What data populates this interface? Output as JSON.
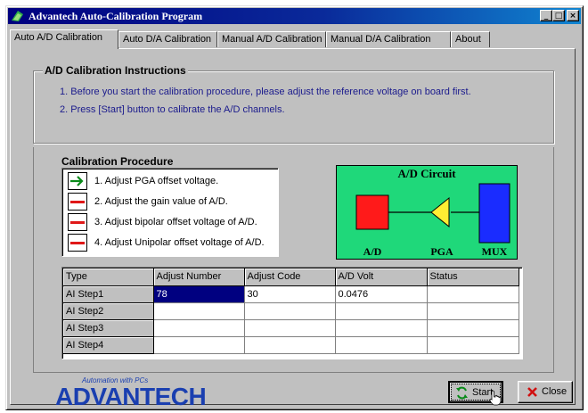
{
  "window": {
    "title": "Advantech Auto-Calibration Program",
    "controls": {
      "minimize": "_",
      "maximize": "□",
      "close": "×"
    }
  },
  "tabs": [
    {
      "label": "Auto A/D Calibration",
      "active": true
    },
    {
      "label": "Auto D/A Calibration",
      "active": false
    },
    {
      "label": "Manual A/D Calibration",
      "active": false
    },
    {
      "label": "Manual D/A Calibration",
      "active": false
    },
    {
      "label": "About",
      "active": false
    }
  ],
  "instructions": {
    "title": "A/D Calibration Instructions",
    "lines": [
      "1. Before you start the calibration procedure, please adjust the reference voltage on board first.",
      "2. Press [Start] button to calibrate the A/D channels."
    ]
  },
  "procedure": {
    "title": "Calibration Procedure",
    "steps": [
      {
        "text": "1. Adjust PGA offset voltage.",
        "icon": "green-arrow-icon"
      },
      {
        "text": "2. Adjust the gain value of A/D.",
        "icon": "red-dash-icon"
      },
      {
        "text": "3. Adjust bipolar offset voltage of A/D.",
        "icon": "red-dash-icon"
      },
      {
        "text": "4. Adjust Unipolar offset voltage of A/D.",
        "icon": "red-dash-icon"
      }
    ]
  },
  "circuit": {
    "title": "A/D Circuit",
    "labels": {
      "ad": "A/D",
      "pga": "PGA",
      "mux": "MUX"
    },
    "colors": {
      "background": "#1fd87a",
      "ad": "#ff1a1a",
      "pga": "#ffee33",
      "mux": "#1a2cff"
    }
  },
  "table": {
    "columns": [
      "Type",
      "Adjust Number",
      "Adjust Code",
      "A/D Volt",
      "Status"
    ],
    "rows": [
      {
        "type": "AI Step1",
        "adjust_number": "78",
        "adjust_code": "30",
        "ad_volt": "0.0476",
        "status": ""
      },
      {
        "type": "AI Step2",
        "adjust_number": "",
        "adjust_code": "",
        "ad_volt": "",
        "status": ""
      },
      {
        "type": "AI Step3",
        "adjust_number": "",
        "adjust_code": "",
        "ad_volt": "",
        "status": ""
      },
      {
        "type": "AI Step4",
        "adjust_number": "",
        "adjust_code": "",
        "ad_volt": "",
        "status": ""
      }
    ]
  },
  "logo": {
    "tagline": "Automation with PCs",
    "text": "ADVANTECH"
  },
  "buttons": {
    "start": "Start",
    "close": "Close"
  },
  "colors": {
    "selection": "#000080",
    "instruction_text": "#1a1a8c",
    "titlebar": "#000080"
  }
}
